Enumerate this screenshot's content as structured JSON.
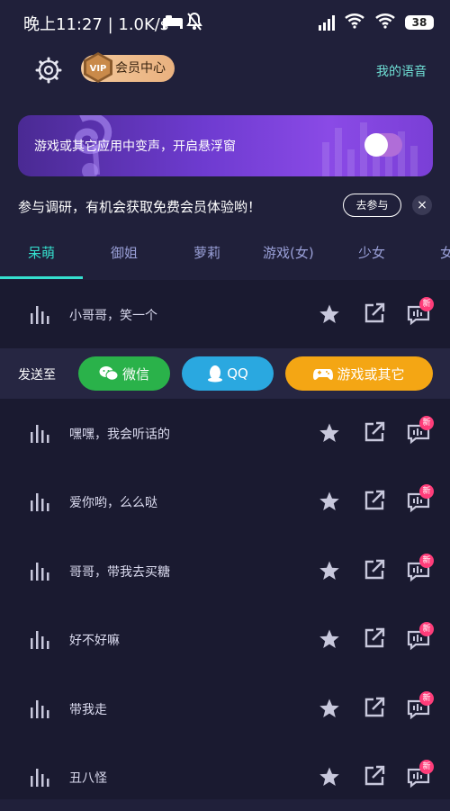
{
  "status_bar": {
    "time_speed": "晚上11:27 | 1.0K/s",
    "battery": "38"
  },
  "header": {
    "vip_badge": "VIP",
    "vip_label": "会员中心",
    "my_voice": "我的语音"
  },
  "banner": {
    "text": "游戏或其它应用中变声，开启悬浮窗",
    "toggle_on": true
  },
  "survey": {
    "text": "参与调研，有机会获取免费会员体验哟！",
    "button": "去参与",
    "close": "×"
  },
  "tabs": [
    {
      "label": "呆萌",
      "active": true
    },
    {
      "label": "御姐",
      "active": false
    },
    {
      "label": "萝莉",
      "active": false
    },
    {
      "label": "游戏(女)",
      "active": false
    },
    {
      "label": "少女",
      "active": false
    },
    {
      "label": "女",
      "active": false
    }
  ],
  "send_bar": {
    "label": "发送至",
    "wechat": "微信",
    "qq": "QQ",
    "game": "游戏或其它"
  },
  "list": {
    "new_badge": "新",
    "items": [
      {
        "label": "小哥哥，笑一个"
      },
      {
        "label": "嘿嘿，我会听话的"
      },
      {
        "label": "爱你哟，么么哒"
      },
      {
        "label": "哥哥，带我去买糖"
      },
      {
        "label": "好不好嘛"
      },
      {
        "label": "带我走"
      },
      {
        "label": "丑八怪"
      }
    ]
  },
  "colors": {
    "accent": "#35e0cf",
    "background": "#20203a",
    "new_badge": "#ff3d7a"
  }
}
